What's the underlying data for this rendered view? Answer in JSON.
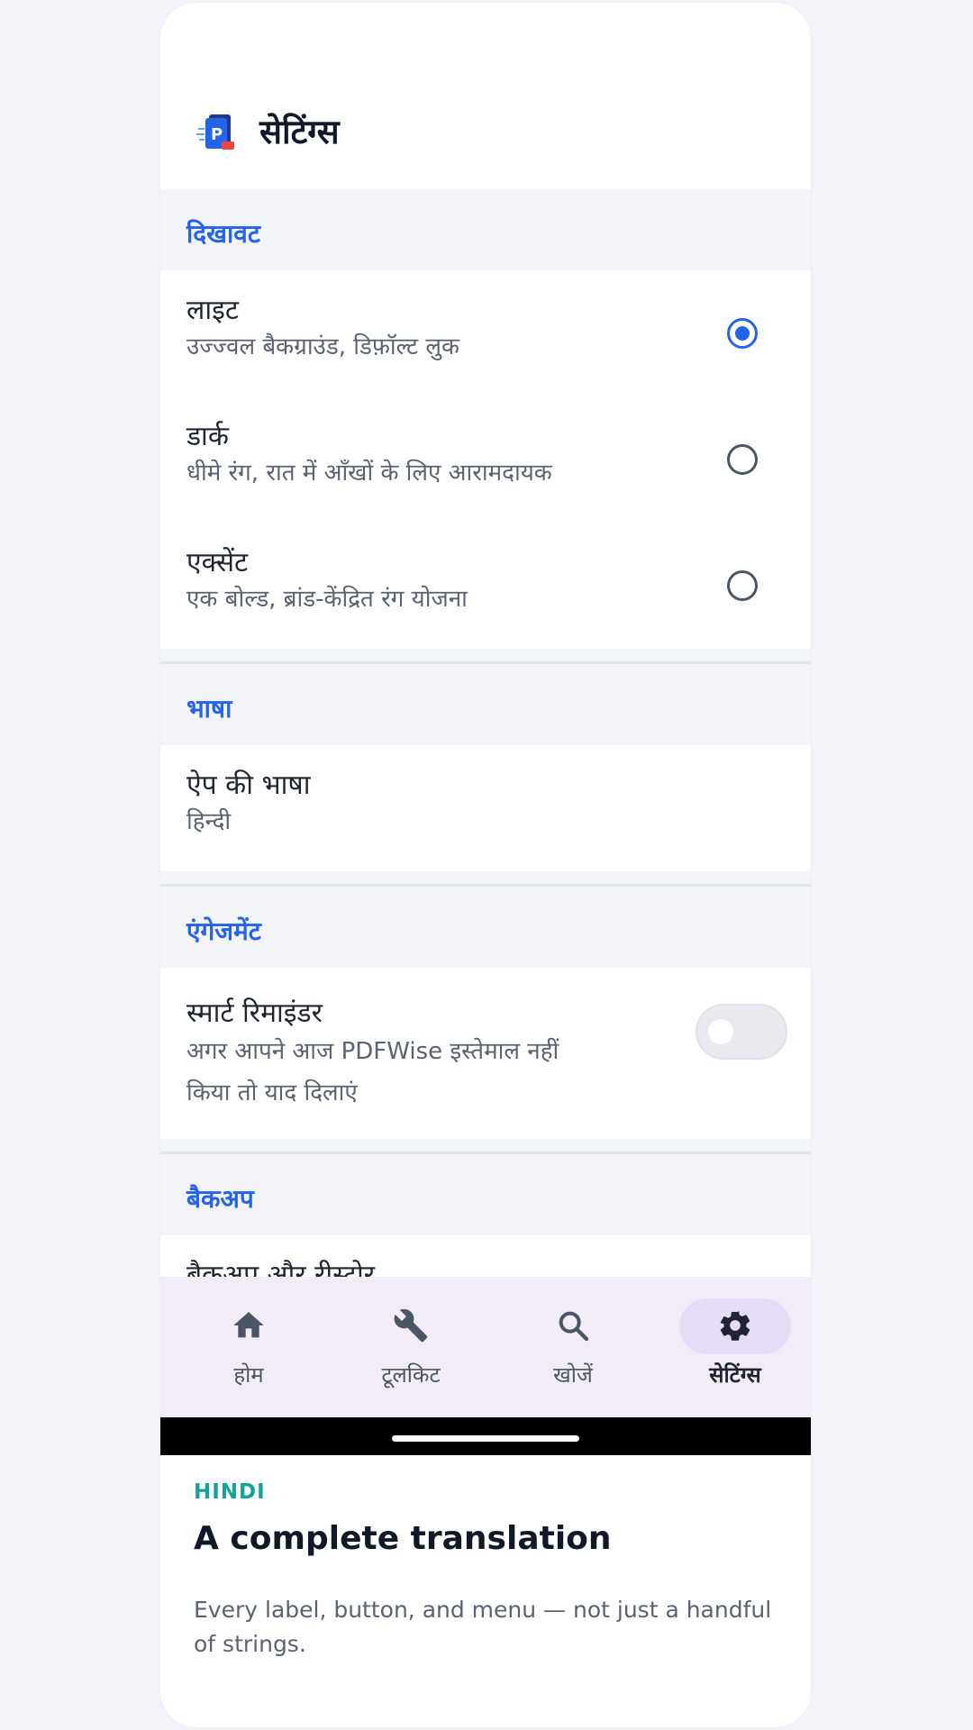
{
  "app": {
    "title": "सेटिंग्स",
    "logo_icon": "pdf-document-icon"
  },
  "sections": {
    "appearance": {
      "header": "दिखावट",
      "options": [
        {
          "title": "लाइट",
          "subtitle": "उज्ज्वल बैकग्राउंड, डिफ़ॉल्ट लुक",
          "selected": true
        },
        {
          "title": "डार्क",
          "subtitle": "धीमे रंग, रात में आँखों के लिए आरामदायक",
          "selected": false
        },
        {
          "title": "एक्सेंट",
          "subtitle": "एक बोल्ड, ब्रांड-केंद्रित रंग योजना",
          "selected": false
        }
      ]
    },
    "language": {
      "header": "भाषा",
      "title": "ऐप की भाषा",
      "value": "हिन्दी"
    },
    "engagement": {
      "header": "एंगेजमेंट",
      "title": "स्मार्ट रिमाइंडर",
      "subtitle_line1": "अगर आपने आज PDFWise इस्तेमाल नहीं",
      "subtitle_line2": "किया तो याद दिलाएं",
      "toggle_on": false
    },
    "backup": {
      "header": "बैकअप",
      "partial_item": "बैकअप और रीस्टोर"
    }
  },
  "nav": {
    "items": [
      {
        "label": "होम",
        "icon": "home-icon",
        "active": false
      },
      {
        "label": "टूलकिट",
        "icon": "wrench-icon",
        "active": false
      },
      {
        "label": "खोजें",
        "icon": "search-icon",
        "active": false
      },
      {
        "label": "सेटिंग्स",
        "icon": "gear-icon",
        "active": true
      }
    ]
  },
  "caption": {
    "eyebrow": "HINDI",
    "title": "A complete translation",
    "body": "Every label, button, and menu — not just a handful of strings."
  },
  "colors": {
    "accent": "#2563eb",
    "caption_accent": "#14a39a",
    "nav_background": "#f2ecf6",
    "nav_active_pill": "#e6dcf6"
  }
}
